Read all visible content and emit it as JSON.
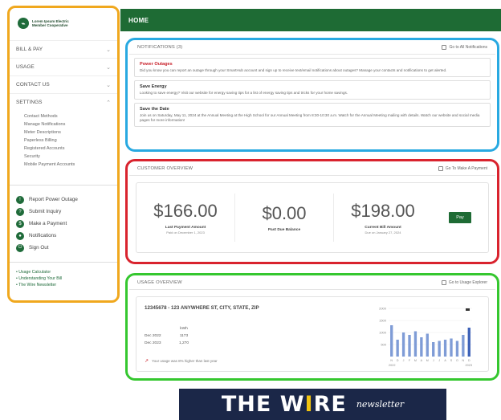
{
  "header": {
    "title": "HOME"
  },
  "sidebar": {
    "logo_text": [
      "Lorem Ipsum Electric",
      "Member Cooperative"
    ],
    "nav": [
      {
        "label": "BILL & PAY"
      },
      {
        "label": "USAGE"
      },
      {
        "label": "CONTACT US"
      },
      {
        "label": "SETTINGS"
      }
    ],
    "settings_items": [
      "Contact Methods",
      "Manage Notifications",
      "Meter Descriptions",
      "Paperless Billing",
      "Registered Accounts",
      "Security",
      "Mobile Payment Accounts"
    ],
    "quick_actions": [
      {
        "icon": "alert-icon",
        "label": "Report Power Outage"
      },
      {
        "icon": "inquiry-icon",
        "label": "Submit Inquiry"
      },
      {
        "icon": "payment-icon",
        "label": "Make a Payment"
      },
      {
        "icon": "bell-icon",
        "label": "Notifications"
      },
      {
        "icon": "signout-icon",
        "label": "Sign Out"
      }
    ],
    "links": [
      "Usage Calculator",
      "Understanding Your Bill",
      "The Wire Newsletter"
    ]
  },
  "notifications": {
    "title": "NOTIFICATIONS (3)",
    "action": "Go to All Notifications",
    "items": [
      {
        "title": "Power Outages",
        "body": "Did you know you can report an outage through your SmartHub account and sign up to receive text/email notifications about outages? Manage your contacts and notifications to get alerted.",
        "alert": true
      },
      {
        "title": "Save Energy",
        "body": "Looking to save energy? Visit our website for energy saving tips for a list of energy saving tips and tricks for your home savings.",
        "alert": false
      },
      {
        "title": "Save the Date",
        "body": "Join us on Saturday, May 11, 2024 at the Annual Meeting at the High School for our Annual Meeting from 8:30-10:30 a.m. Watch for the Annual Meeting mailing with details. Watch our website and social media pages for more information!",
        "alert": false
      }
    ]
  },
  "customer_overview": {
    "title": "CUSTOMER OVERVIEW",
    "action": "Go To Make A Payment",
    "columns": [
      {
        "amount": "$166.00",
        "label": "Last Payment Amount",
        "sub": "Paid on December 1, 2023"
      },
      {
        "amount": "$0.00",
        "label": "Past Due Balance",
        "sub": ""
      },
      {
        "amount": "$198.00",
        "label": "Current Bill Amount",
        "sub": "Due on January 27, 2024"
      }
    ],
    "pay_label": "Pay"
  },
  "usage_overview": {
    "title": "USAGE OVERVIEW",
    "action": "Go to Usage Explorer",
    "account_line": "12345678 - 123 ANYWHERE ST, CITY, STATE, ZIP",
    "table_header": "kWh",
    "rows": [
      {
        "period": "Dec 2022",
        "value": "1173"
      },
      {
        "period": "Dec 2023",
        "value": "1,270"
      }
    ],
    "note": "Your usage was 8% higher than last year"
  },
  "banner": {
    "main_pre": "THE W",
    "main_bolt": "I",
    "main_post": "RE",
    "sub": "newsletter"
  },
  "chart_data": {
    "type": "bar",
    "series": [
      {
        "values": [
          1300,
          700,
          1000,
          900,
          1050,
          800,
          950,
          600,
          650,
          700,
          750,
          650,
          900,
          1200
        ]
      }
    ],
    "categories": [
      "N",
      "D",
      "J",
      "F",
      "M",
      "A",
      "M",
      "J",
      "J",
      "A",
      "S",
      "O",
      "N",
      "D"
    ],
    "xlabel_left": "2022",
    "xlabel_right": "2023",
    "yticks": [
      2000,
      1500,
      1000,
      500
    ],
    "ylim": [
      0,
      2000
    ],
    "colors": {
      "bar": "#7f9cd6",
      "last_bar": "#3e62b8"
    }
  }
}
